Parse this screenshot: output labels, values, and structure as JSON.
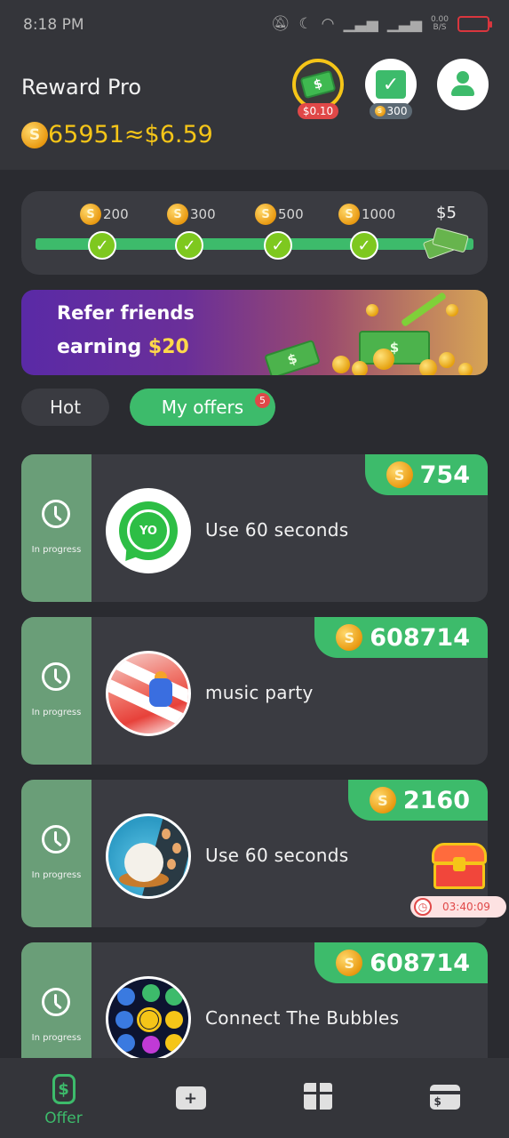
{
  "status_bar": {
    "time": "8:18 PM",
    "net_speed_value": "0.00",
    "net_speed_unit": "B/S",
    "battery_level": "",
    "icons": [
      "mute-icon",
      "moon-icon",
      "wifi-icon",
      "signal-icon",
      "signal-icon",
      "battery-icon"
    ]
  },
  "header": {
    "title": "Reward Pro",
    "coin_balance": "65951",
    "approx_value": "≈$6.59",
    "cash_badge": "$0.10",
    "checkin_badge": "300"
  },
  "milestones": {
    "steps": [
      {
        "label": "200",
        "completed": true
      },
      {
        "label": "300",
        "completed": true
      },
      {
        "label": "500",
        "completed": true
      },
      {
        "label": "1000",
        "completed": true
      }
    ],
    "final_reward": "$5"
  },
  "banner": {
    "line1": "Refer friends",
    "line2_prefix": "earning",
    "line2_amount": "$20"
  },
  "tabs": {
    "hot": "Hot",
    "my_offers": "My offers",
    "my_offers_count": "5",
    "active": "my_offers"
  },
  "offers": [
    {
      "reward": "754",
      "title": "Use 60 seconds",
      "status": "In progress",
      "icon": "whatsapp-yo-icon",
      "icon_text": "YO"
    },
    {
      "reward": "608714",
      "title": "music party",
      "status": "In progress",
      "icon": "music-party-icon"
    },
    {
      "reward": "2160",
      "title": "Use 60 seconds",
      "status": "In progress",
      "icon": "hen-egg-game-icon"
    },
    {
      "reward": "608714",
      "title": "Connect The Bubbles",
      "status": "In progress",
      "icon": "bubbles-game-icon"
    }
  ],
  "floating": {
    "timer": "03:40:09"
  },
  "bottom_nav": {
    "items": [
      {
        "label": "Offer",
        "icon": "offer-icon",
        "active": true
      },
      {
        "label": "",
        "icon": "inbox-icon",
        "active": false
      },
      {
        "label": "",
        "icon": "gift-icon",
        "active": false
      },
      {
        "label": "",
        "icon": "wallet-icon",
        "active": false
      }
    ]
  },
  "colors": {
    "accent_green": "#3dbb6b",
    "coin_gold": "#f5c518",
    "background": "#2a2b30",
    "card": "#3a3b41",
    "badge_red": "#e04848"
  }
}
